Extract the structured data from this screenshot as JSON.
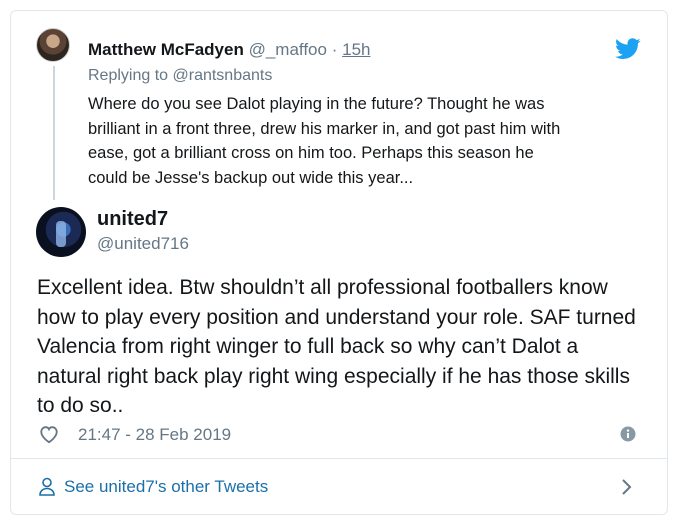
{
  "parent_tweet": {
    "display_name": "Matthew McFadyen",
    "handle": "@_maffoo",
    "separator": "·",
    "time": "15h",
    "replying_to": "Replying to @rantsnbants",
    "text_lines": [
      "Where do you see Dalot playing in the future?  Thought he was",
      "brilliant in a front three, drew his marker in, and got past him with",
      "ease, got a brilliant cross on him too.  Perhaps this season he",
      "could be Jesse's backup out wide this year..."
    ]
  },
  "main_tweet": {
    "display_name": "united7",
    "handle": "@united716",
    "text_lines": [
      "Excellent idea.  Btw shouldn’t all professional footballers know",
      "how to play every position and understand your role. SAF turned",
      "Valencia from right winger to full back so why can’t Dalot a",
      "natural right back play right wing especially if he has those skills",
      "to do so.."
    ],
    "timestamp": "21:47 - 28 Feb 2019"
  },
  "footer": {
    "see_more_label": "See united7's other Tweets"
  },
  "colors": {
    "twitter_blue": "#1da1f2",
    "secondary_text": "#657786",
    "link": "#1b6fa8",
    "border": "#e1e8ed"
  },
  "icons": [
    "twitter-bird-icon",
    "heart-icon",
    "info-icon",
    "person-icon",
    "chevron-right-icon"
  ]
}
